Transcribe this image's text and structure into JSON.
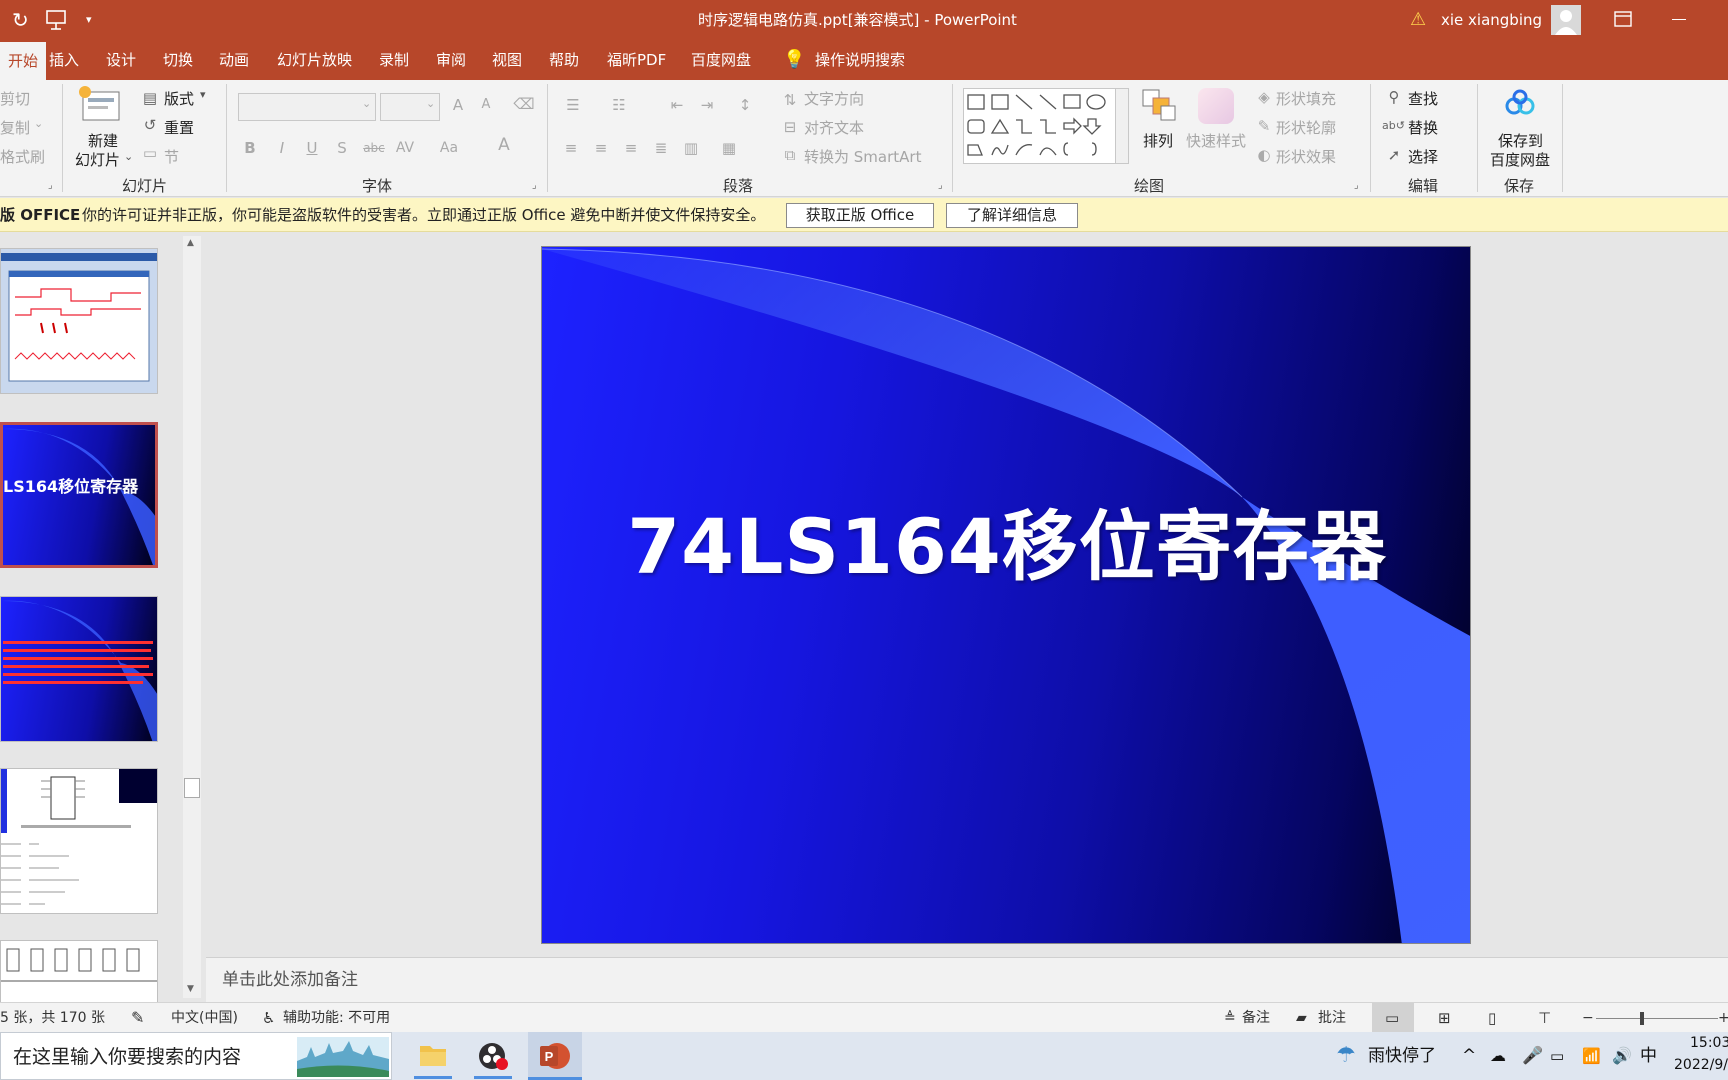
{
  "window": {
    "title": "时序逻辑电路仿真.ppt[兼容模式]  -  PowerPoint",
    "user": "xie xiangbing"
  },
  "tabs": [
    "开始",
    "插入",
    "设计",
    "切换",
    "动画",
    "幻灯片放映",
    "录制",
    "审阅",
    "视图",
    "帮助",
    "福昕PDF",
    "百度网盘"
  ],
  "tell_me": "操作说明搜索",
  "ribbon": {
    "clipboard": {
      "cut": "剪切",
      "copy": "复制",
      "painter": "格式刷"
    },
    "slides": {
      "new_slide_line1": "新建",
      "new_slide_line2": "幻灯片",
      "layout": "版式",
      "reset": "重置",
      "section": "节",
      "group": "幻灯片"
    },
    "font": {
      "group": "字体",
      "bold": "B",
      "italic": "I",
      "underline": "U",
      "shadow": "S",
      "strike": "abc",
      "spacing": "AV",
      "case": "Aa",
      "grow": "A",
      "shrink": "A",
      "color": "A"
    },
    "paragraph": {
      "group": "段落",
      "text_direction": "文字方向",
      "align_text": "对齐文本",
      "smartart": "转换为 SmartArt"
    },
    "drawing": {
      "group": "绘图",
      "arrange": "排列",
      "quick_styles": "快速样式",
      "shape_fill": "形状填充",
      "shape_outline": "形状轮廓",
      "shape_effects": "形状效果"
    },
    "editing": {
      "group": "编辑",
      "find": "查找",
      "replace": "替换",
      "select": "选择"
    },
    "save": {
      "group": "保存",
      "line1": "保存到",
      "line2": "百度网盘"
    }
  },
  "notification": {
    "label": "版 OFFICE",
    "message": "你的许可证并非正版，你可能是盗版软件的受害者。立即通过正版 Office 避免中断并使文件保持安全。",
    "btn_genuine": "获取正版 Office",
    "btn_learn": "了解详细信息"
  },
  "thumbnails": {
    "current_title": "LS164移位寄存器"
  },
  "slide": {
    "title": "74LS164移位寄存器"
  },
  "notes_placeholder": "单击此处添加备注",
  "status": {
    "slide_count": "5 张，共 170 张",
    "language": "中文(中国)",
    "accessibility": "辅助功能: 不可用",
    "notes": "备注",
    "comments": "批注",
    "zoom_minus": "−",
    "zoom_plus": "+"
  },
  "taskbar": {
    "search_placeholder": "在这里输入你要搜索的内容",
    "weather": "雨快停了",
    "ime": "中",
    "time": "15:03",
    "date": "2022/9/"
  }
}
